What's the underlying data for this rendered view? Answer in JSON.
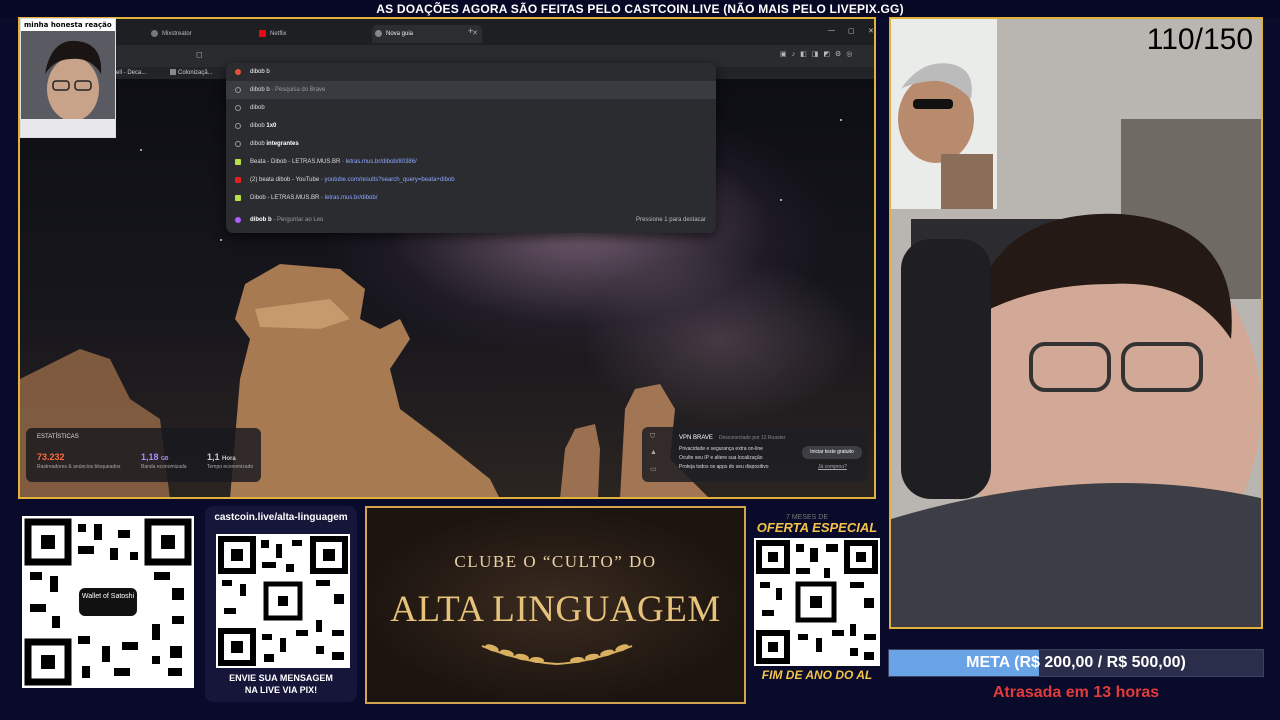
{
  "banner": "AS DOAÇÕES AGORA SÃO FEITAS PELO CASTCOIN.LIVE (NÃO MAIS PELO LIVEPIX.GG)",
  "webcam_label": "minha honesta reação",
  "browser": {
    "tabs": [
      {
        "label": "Mixstreator",
        "icon_color": "#777777"
      },
      {
        "label": "Netflix",
        "icon_color": "#e50914"
      },
      {
        "label": "Nova guia",
        "icon_color": "#888888",
        "active": true
      }
    ],
    "bookmarks": [
      "ell - Deca...",
      "Colonizaçã..."
    ],
    "omnibox": {
      "query": "dibob b",
      "suggestions": [
        {
          "icon": "search-icon",
          "bold": "",
          "text": "dibob b",
          "suffix": " - Pesquisa do Brave",
          "url": ""
        },
        {
          "icon": "search-icon",
          "bold": "",
          "text": "dibob",
          "suffix": "",
          "url": ""
        },
        {
          "icon": "search-icon",
          "bold": "1x0",
          "text": "dibob ",
          "suffix": "",
          "url": ""
        },
        {
          "icon": "search-icon",
          "bold": "integrantes",
          "text": "dibob ",
          "suffix": "",
          "url": ""
        },
        {
          "icon": "letras-icon",
          "bold": "",
          "text": "Beata - Dibob - LETRAS.MUS.BR",
          "suffix": " - ",
          "url": "letras.mus.br/dibob/80386/"
        },
        {
          "icon": "youtube-icon",
          "bold": "",
          "text": "(2) beata dibob - YouTube",
          "suffix": " - ",
          "url": "youtube.com/results?search_query=beata+dibob"
        },
        {
          "icon": "letras-icon",
          "bold": "",
          "text": "Dibob - LETRAS.MUS.BR",
          "suffix": " - ",
          "url": "letras.mus.br/dibob/"
        }
      ],
      "ask_leo": {
        "query": "dibob b",
        "suffix": " - Perguntar ao Leo",
        "hint": "Pressione 1 para destacar"
      }
    },
    "stats": {
      "title": "ESTATÍSTICAS",
      "items": [
        {
          "value": "73.232",
          "unit": "",
          "label": "Rastreadores & anúncios bloqueados",
          "color": "#ff6a3d"
        },
        {
          "value": "1,18",
          "unit": "GB",
          "label": "Banda economizada",
          "color": "#a88bff"
        },
        {
          "value": "1,1",
          "unit": "Hora",
          "label": "Tempo economizado",
          "color": "#ffffff"
        }
      ]
    },
    "vpn": {
      "title": "VPN BRAVE",
      "status": "Desconectado por 12 Roaster",
      "lines": [
        "Privacidade e segurança extra on-line",
        "Oculte seu IP e altere sua localização",
        "Proteja todos os apps do seu dispositivo"
      ],
      "button": "Iniciar teste gratuito",
      "link": "Já comprou?"
    }
  },
  "counter": "110/150",
  "qr_wallet_label": "Wallet of Satoshi",
  "pix": {
    "link": "castcoin.live/alta-linguagem",
    "message_line1": "ENVIE SUA MENSAGEM",
    "message_line2": "NA LIVE VIA PIX!"
  },
  "clube": {
    "line1": "CLUBE O “CULTO” DO",
    "line2": "ALTA LINGUAGEM"
  },
  "oferta": {
    "title": "OFERTA ESPECIAL",
    "small": "7 MESES DE",
    "footer": "FIM DE ANO DO AL"
  },
  "meta": {
    "text": "META (R$ 200,00 / R$ 500,00)",
    "progress": 0.4,
    "fill_color": "#6aa2e6"
  },
  "atrasada": "Atrasada em 13 horas"
}
